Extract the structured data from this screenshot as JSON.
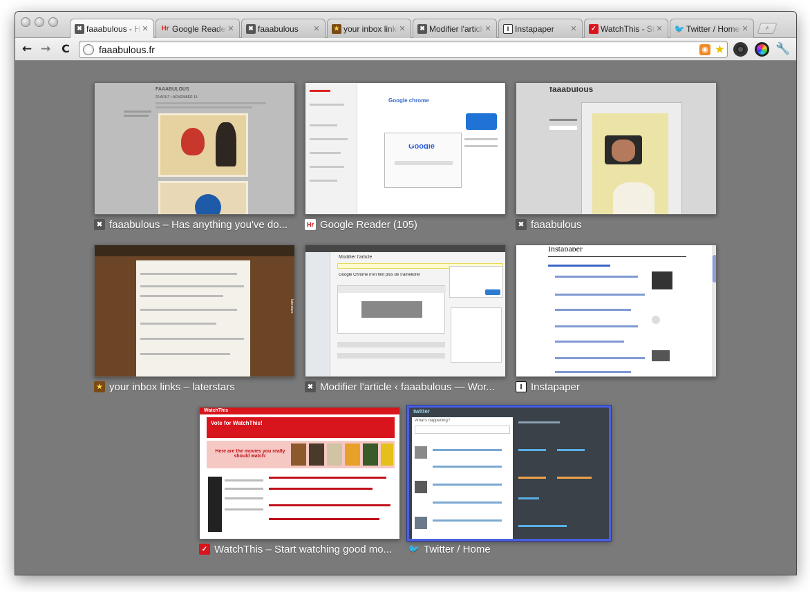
{
  "tabs": [
    {
      "title": "faaabulous - H",
      "icon": "faaabulous-x-icon",
      "active": true
    },
    {
      "title": "Google Reader",
      "icon": "google-reader-icon"
    },
    {
      "title": "faaabulous",
      "icon": "faaabulous-x-icon"
    },
    {
      "title": "your inbox links",
      "icon": "laterstars-icon"
    },
    {
      "title": "Modifier l'article",
      "icon": "faaabulous-x-icon"
    },
    {
      "title": "Instapaper",
      "icon": "instapaper-icon"
    },
    {
      "title": "WatchThis - St",
      "icon": "watchthis-icon"
    },
    {
      "title": "Twitter / Home",
      "icon": "twitter-bird-icon"
    }
  ],
  "toolbar": {
    "url": "faaabulous.fr",
    "back": "←",
    "forward": "→",
    "reload": "C"
  },
  "thumbnails": [
    {
      "caption": "faaabulous – Has anything you've do...",
      "fav": "✖",
      "blog_title": "FAAABULOUS",
      "blog_sub": "20 AOÛT • NOVEMBER 13"
    },
    {
      "caption": "Google Reader (105)",
      "fav": "Hr",
      "article_title": "Google chrome",
      "search_logo": "Google"
    },
    {
      "caption": "faaabulous",
      "fav": "✖",
      "blog_title": "faaabulous"
    },
    {
      "caption": "your inbox links – laterstars",
      "fav": "★",
      "side_label": "laterstars"
    },
    {
      "caption": "Modifier l'article ‹ faaabulous — Wor...",
      "fav": "✖",
      "editor_title": "Modifier l'article",
      "post_title": "Google Chrome n'en finit plus de s'améliorer"
    },
    {
      "caption": "Instapaper",
      "fav": "I",
      "brand": "Instapaper"
    },
    {
      "caption": "WatchThis – Start watching good mo...",
      "fav": "✓",
      "brand": "WatchThis",
      "vote": "Vote for WatchThis!",
      "movies": "Here are the movies you really should watch:"
    },
    {
      "caption": "Twitter / Home",
      "fav": "🐦",
      "brand": "twitter",
      "prompt": "What's happening?"
    }
  ],
  "colors": {
    "content_bg": "#7a7a7a",
    "selection": "#4a5fe0",
    "watchthis_red": "#d8141c",
    "twitter_dark": "#3a4148",
    "wood": "#6b4526"
  }
}
